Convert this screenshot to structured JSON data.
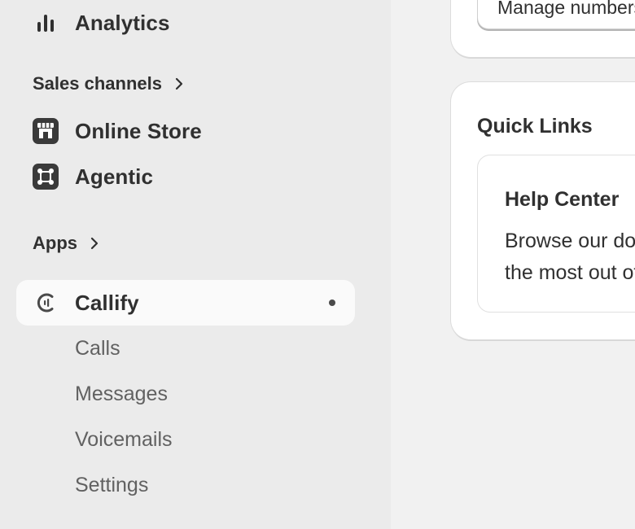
{
  "sidebar": {
    "analytics": {
      "label": "Analytics",
      "icon": "bar-chart-icon"
    },
    "sales_channels": {
      "header": "Sales channels",
      "items": [
        {
          "label": "Online Store",
          "icon": "store-icon"
        },
        {
          "label": "Agentic",
          "icon": "agentic-icon"
        }
      ]
    },
    "apps": {
      "header": "Apps",
      "selected": {
        "label": "Callify",
        "icon": "callify-logo-icon"
      },
      "subitems": [
        "Calls",
        "Messages",
        "Voicemails",
        "Settings"
      ]
    }
  },
  "main": {
    "manage_button": "Manage numbers",
    "quick_links": {
      "title": "Quick Links",
      "help_center": {
        "title": "Help Center",
        "description": "Browse our documentation to get the most out of Callify."
      }
    }
  },
  "colors": {
    "sidebar_bg": "#ebebeb",
    "main_bg": "#f1f1f1",
    "text": "#303030",
    "subtext": "#616161"
  }
}
